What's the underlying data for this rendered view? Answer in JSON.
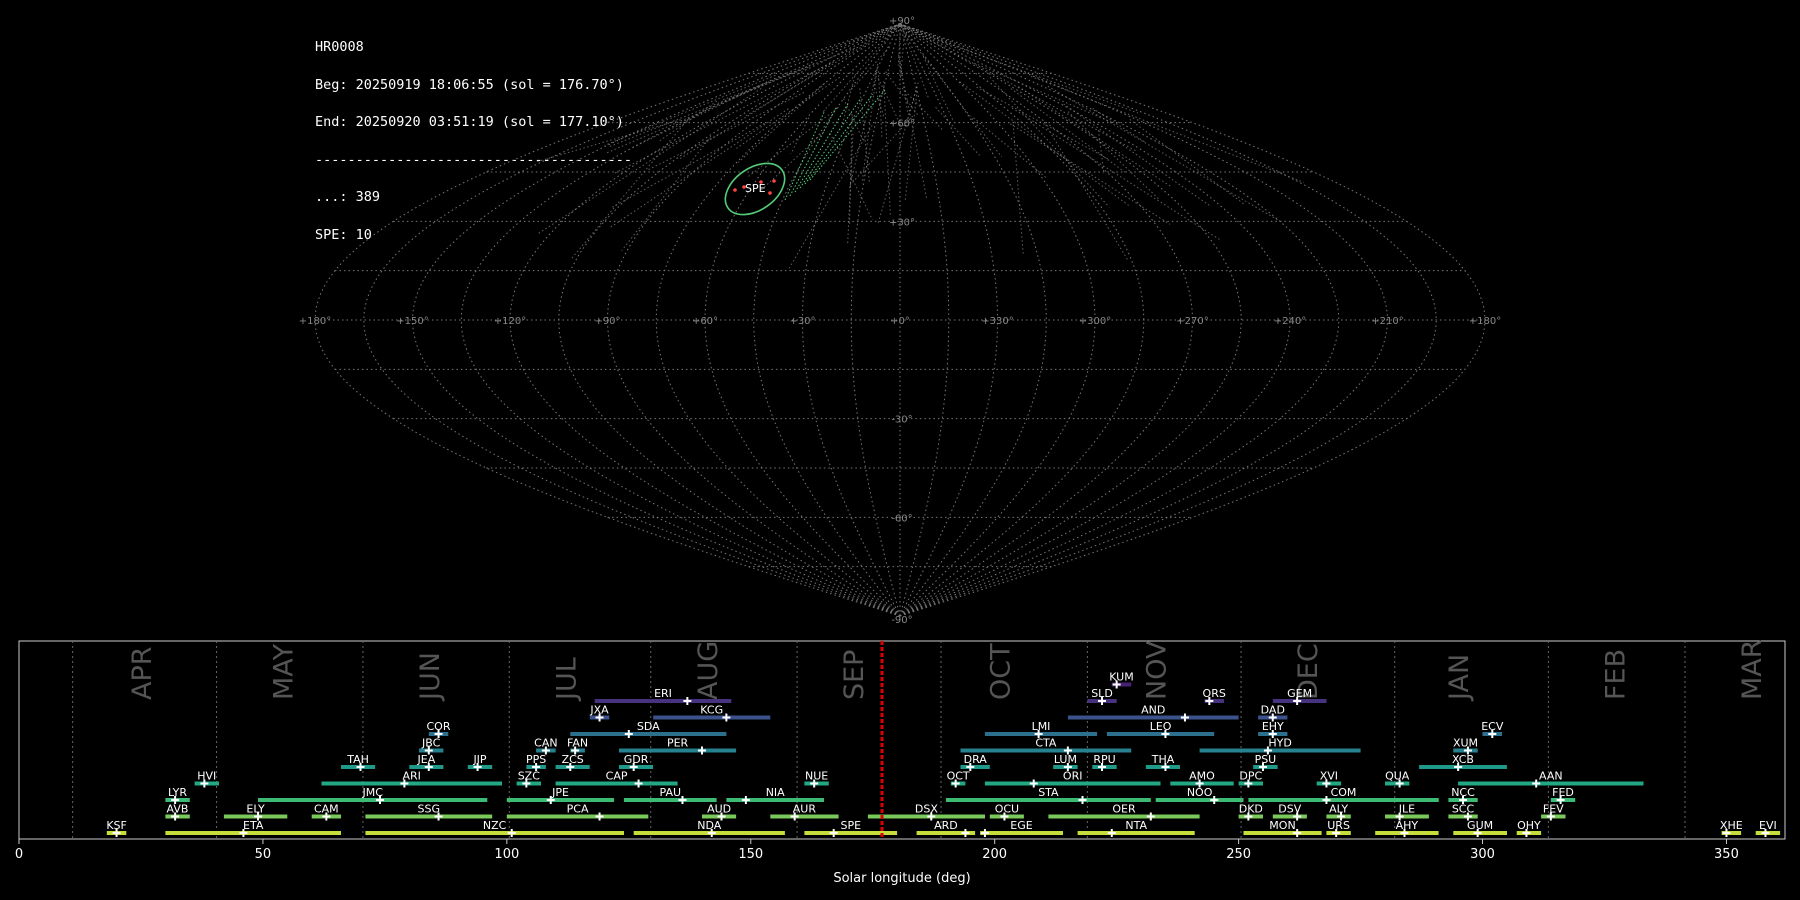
{
  "info": {
    "lines": [
      "HR0008",
      "Beg: 20250919 18:06:55 (sol = 176.70°)",
      "End: 20250920 03:51:19 (sol = 177.10°)",
      "---------------------------------------",
      "...: 389",
      "SPE: 10"
    ]
  },
  "sky": {
    "projection": "sinusoidal",
    "lon_labels": [
      "+180°",
      "+150°",
      "+120°",
      "+90°",
      "+60°",
      "+30°",
      "+0°",
      "+330°",
      "+300°",
      "+270°",
      "+240°",
      "+210°",
      "+180°"
    ],
    "lat_labels": [
      "+90°",
      "+60°",
      "+30°",
      "-30°",
      "-60°",
      "-90°"
    ],
    "highlight_label": "SPE",
    "highlight_color": "#55cc77",
    "track_color": "#888888",
    "spe_color": "#ff4444"
  },
  "chart_data": {
    "type": "timeline",
    "xlabel": "Solar longitude (deg)",
    "xlim": [
      0,
      362
    ],
    "xticks": [
      0,
      50,
      100,
      150,
      200,
      250,
      300,
      350
    ],
    "current_sol": 176.9,
    "current_color": "#dd0000",
    "months": [
      {
        "name": "APR",
        "sol": 25
      },
      {
        "name": "MAY",
        "sol": 54
      },
      {
        "name": "JUN",
        "sol": 84
      },
      {
        "name": "JUL",
        "sol": 112
      },
      {
        "name": "AUG",
        "sol": 141
      },
      {
        "name": "SEP",
        "sol": 171
      },
      {
        "name": "OCT",
        "sol": 201
      },
      {
        "name": "NOV",
        "sol": 233
      },
      {
        "name": "DEC",
        "sol": 264
      },
      {
        "name": "JAN",
        "sol": 295
      },
      {
        "name": "FEB",
        "sol": 327
      },
      {
        "name": "MAR",
        "sol": 355
      }
    ],
    "month_dividers": [
      11,
      40.5,
      70.5,
      100.5,
      129.5,
      159.5,
      189,
      219,
      250.5,
      282,
      313.5,
      341.5
    ],
    "showers": [
      {
        "code": "KSF",
        "start": 18,
        "end": 22,
        "peak": 20,
        "row": 0,
        "color": "#c7dd3a"
      },
      {
        "code": "ETA",
        "start": 30,
        "end": 66,
        "peak": 46,
        "row": 0,
        "color": "#c7dd3a"
      },
      {
        "code": "NZC",
        "start": 71,
        "end": 124,
        "peak": 101,
        "row": 0,
        "color": "#c7dd3a"
      },
      {
        "code": "NDA",
        "start": 126,
        "end": 157,
        "peak": 142,
        "row": 0,
        "color": "#c7dd3a"
      },
      {
        "code": "SPE",
        "start": 161,
        "end": 180,
        "peak": 167,
        "row": 0,
        "color": "#c7dd3a"
      },
      {
        "code": "ARD",
        "start": 184,
        "end": 196,
        "peak": 194,
        "row": 0,
        "color": "#c7dd3a"
      },
      {
        "code": "EGE",
        "start": 197,
        "end": 214,
        "peak": 198,
        "row": 0,
        "color": "#c7dd3a"
      },
      {
        "code": "NTA",
        "start": 217,
        "end": 241,
        "peak": 224,
        "row": 0,
        "color": "#c7dd3a"
      },
      {
        "code": "MON",
        "start": 251,
        "end": 267,
        "peak": 262,
        "row": 0,
        "color": "#c7dd3a"
      },
      {
        "code": "URS",
        "start": 268,
        "end": 273,
        "peak": 270,
        "row": 0,
        "color": "#c7dd3a"
      },
      {
        "code": "AHY",
        "start": 278,
        "end": 291,
        "peak": 284,
        "row": 0,
        "color": "#c7dd3a"
      },
      {
        "code": "GUM",
        "start": 294,
        "end": 305,
        "peak": 299,
        "row": 0,
        "color": "#c7dd3a"
      },
      {
        "code": "OHY",
        "start": 307,
        "end": 312,
        "peak": 309,
        "row": 0,
        "color": "#c7dd3a"
      },
      {
        "code": "XHE",
        "start": 349,
        "end": 353,
        "peak": 350,
        "row": 0,
        "color": "#c7dd3a"
      },
      {
        "code": "EVI",
        "start": 356,
        "end": 361,
        "peak": 358,
        "row": 0,
        "color": "#c7dd3a"
      },
      {
        "code": "AVB",
        "start": 30,
        "end": 35,
        "peak": 32,
        "row": 1,
        "color": "#7ac95b"
      },
      {
        "code": "ELY",
        "start": 42,
        "end": 55,
        "peak": 49,
        "row": 1,
        "color": "#7ac95b"
      },
      {
        "code": "CAM",
        "start": 60,
        "end": 66,
        "peak": 63,
        "row": 1,
        "color": "#7ac95b"
      },
      {
        "code": "SSG",
        "start": 71,
        "end": 97,
        "peak": 86,
        "row": 1,
        "color": "#7ac95b"
      },
      {
        "code": "PCA",
        "start": 100,
        "end": 129,
        "peak": 119,
        "row": 1,
        "color": "#7ac95b"
      },
      {
        "code": "AUD",
        "start": 140,
        "end": 147,
        "peak": 144,
        "row": 1,
        "color": "#7ac95b"
      },
      {
        "code": "AUR",
        "start": 154,
        "end": 168,
        "peak": 159,
        "row": 1,
        "color": "#7ac95b"
      },
      {
        "code": "DSX",
        "start": 174,
        "end": 198,
        "peak": 187,
        "row": 1,
        "color": "#7ac95b"
      },
      {
        "code": "OCU",
        "start": 199,
        "end": 206,
        "peak": 202,
        "row": 1,
        "color": "#7ac95b"
      },
      {
        "code": "OER",
        "start": 211,
        "end": 242,
        "peak": 232,
        "row": 1,
        "color": "#7ac95b"
      },
      {
        "code": "DKD",
        "start": 250,
        "end": 255,
        "peak": 252,
        "row": 1,
        "color": "#7ac95b"
      },
      {
        "code": "DSV",
        "start": 257,
        "end": 264,
        "peak": 262,
        "row": 1,
        "color": "#7ac95b"
      },
      {
        "code": "ALY",
        "start": 268,
        "end": 273,
        "peak": 271,
        "row": 1,
        "color": "#7ac95b"
      },
      {
        "code": "ILE",
        "start": 280,
        "end": 289,
        "peak": 283,
        "row": 1,
        "color": "#7ac95b"
      },
      {
        "code": "SCC",
        "start": 293,
        "end": 299,
        "peak": 297,
        "row": 1,
        "color": "#7ac95b"
      },
      {
        "code": "FEV",
        "start": 312,
        "end": 317,
        "peak": 314,
        "row": 1,
        "color": "#7ac95b"
      },
      {
        "code": "LYR",
        "start": 30,
        "end": 35,
        "peak": 32,
        "row": 2,
        "color": "#3dbb75"
      },
      {
        "code": "JMC",
        "start": 49,
        "end": 96,
        "peak": 74,
        "row": 2,
        "color": "#3dbb75"
      },
      {
        "code": "JPE",
        "start": 100,
        "end": 122,
        "peak": 109,
        "row": 2,
        "color": "#3dbb75"
      },
      {
        "code": "PAU",
        "start": 124,
        "end": 143,
        "peak": 136,
        "row": 2,
        "color": "#3dbb75"
      },
      {
        "code": "NIA",
        "start": 145,
        "end": 165,
        "peak": 149,
        "row": 2,
        "color": "#3dbb75"
      },
      {
        "code": "STA",
        "start": 190,
        "end": 232,
        "peak": 218,
        "row": 2,
        "color": "#3dbb75"
      },
      {
        "code": "NOO",
        "start": 233,
        "end": 251,
        "peak": 245,
        "row": 2,
        "color": "#3dbb75"
      },
      {
        "code": "COM",
        "start": 252,
        "end": 291,
        "peak": 268,
        "row": 2,
        "color": "#3dbb75"
      },
      {
        "code": "NCC",
        "start": 293,
        "end": 299,
        "peak": 296,
        "row": 2,
        "color": "#3dbb75"
      },
      {
        "code": "FED",
        "start": 314,
        "end": 319,
        "peak": 316,
        "row": 2,
        "color": "#3dbb75"
      },
      {
        "code": "HVI",
        "start": 36,
        "end": 41,
        "peak": 38,
        "row": 3,
        "color": "#22a884"
      },
      {
        "code": "ARI",
        "start": 62,
        "end": 99,
        "peak": 79,
        "row": 3,
        "color": "#22a884"
      },
      {
        "code": "SZC",
        "start": 102,
        "end": 107,
        "peak": 104,
        "row": 3,
        "color": "#22a884"
      },
      {
        "code": "CAP",
        "start": 110,
        "end": 135,
        "peak": 127,
        "row": 3,
        "color": "#22a884"
      },
      {
        "code": "NUE",
        "start": 161,
        "end": 166,
        "peak": 163,
        "row": 3,
        "color": "#22a884"
      },
      {
        "code": "OCT",
        "start": 191,
        "end": 194,
        "peak": 192,
        "row": 3,
        "color": "#22a884"
      },
      {
        "code": "ORI",
        "start": 198,
        "end": 234,
        "peak": 208,
        "row": 3,
        "color": "#22a884"
      },
      {
        "code": "AMO",
        "start": 236,
        "end": 249,
        "peak": 242,
        "row": 3,
        "color": "#22a884"
      },
      {
        "code": "DPC",
        "start": 250,
        "end": 255,
        "peak": 252,
        "row": 3,
        "color": "#22a884"
      },
      {
        "code": "XVI",
        "start": 266,
        "end": 271,
        "peak": 268,
        "row": 3,
        "color": "#22a884"
      },
      {
        "code": "QUA",
        "start": 280,
        "end": 285,
        "peak": 283,
        "row": 3,
        "color": "#22a884"
      },
      {
        "code": "AAN",
        "start": 295,
        "end": 333,
        "peak": 311,
        "row": 3,
        "color": "#22a884"
      },
      {
        "code": "TAH",
        "start": 66,
        "end": 73,
        "peak": 70,
        "row": 4,
        "color": "#1f9a8a"
      },
      {
        "code": "JEA",
        "start": 80,
        "end": 87,
        "peak": 84,
        "row": 4,
        "color": "#1f9a8a"
      },
      {
        "code": "JIP",
        "start": 92,
        "end": 97,
        "peak": 94,
        "row": 4,
        "color": "#1f9a8a"
      },
      {
        "code": "PPS",
        "start": 104,
        "end": 108,
        "peak": 106,
        "row": 4,
        "color": "#1f9a8a"
      },
      {
        "code": "ZCS",
        "start": 110,
        "end": 117,
        "peak": 113,
        "row": 4,
        "color": "#1f9a8a"
      },
      {
        "code": "GDR",
        "start": 123,
        "end": 130,
        "peak": 126,
        "row": 4,
        "color": "#1f9a8a"
      },
      {
        "code": "DRA",
        "start": 193,
        "end": 199,
        "peak": 195,
        "row": 4,
        "color": "#1f9a8a"
      },
      {
        "code": "LUM",
        "start": 212,
        "end": 217,
        "peak": 215,
        "row": 4,
        "color": "#1f9a8a"
      },
      {
        "code": "RPU",
        "start": 220,
        "end": 225,
        "peak": 222,
        "row": 4,
        "color": "#1f9a8a"
      },
      {
        "code": "THA",
        "start": 231,
        "end": 238,
        "peak": 235,
        "row": 4,
        "color": "#1f9a8a"
      },
      {
        "code": "PSU",
        "start": 253,
        "end": 258,
        "peak": 255,
        "row": 4,
        "color": "#1f9a8a"
      },
      {
        "code": "XCB",
        "start": 287,
        "end": 305,
        "peak": 295,
        "row": 4,
        "color": "#1f9a8a"
      },
      {
        "code": "JBC",
        "start": 82,
        "end": 87,
        "peak": 84,
        "row": 5,
        "color": "#26828e"
      },
      {
        "code": "CAN",
        "start": 106,
        "end": 110,
        "peak": 108,
        "row": 5,
        "color": "#26828e"
      },
      {
        "code": "FAN",
        "start": 113,
        "end": 116,
        "peak": 114,
        "row": 5,
        "color": "#26828e"
      },
      {
        "code": "PER",
        "start": 123,
        "end": 147,
        "peak": 140,
        "row": 5,
        "color": "#26828e"
      },
      {
        "code": "CTA",
        "start": 193,
        "end": 228,
        "peak": 215,
        "row": 5,
        "color": "#26828e"
      },
      {
        "code": "HYD",
        "start": 242,
        "end": 275,
        "peak": 256,
        "row": 5,
        "color": "#26828e"
      },
      {
        "code": "XUM",
        "start": 294,
        "end": 299,
        "peak": 297,
        "row": 5,
        "color": "#26828e"
      },
      {
        "code": "COR",
        "start": 84,
        "end": 88,
        "peak": 86,
        "row": 6,
        "color": "#2d708e"
      },
      {
        "code": "SDA",
        "start": 113,
        "end": 145,
        "peak": 125,
        "row": 6,
        "color": "#2d708e"
      },
      {
        "code": "LMI",
        "start": 198,
        "end": 221,
        "peak": 209,
        "row": 6,
        "color": "#2d708e"
      },
      {
        "code": "LEO",
        "start": 223,
        "end": 245,
        "peak": 235,
        "row": 6,
        "color": "#2d708e"
      },
      {
        "code": "EHY",
        "start": 254,
        "end": 260,
        "peak": 257,
        "row": 6,
        "color": "#2d708e"
      },
      {
        "code": "ECV",
        "start": 300,
        "end": 304,
        "peak": 302,
        "row": 6,
        "color": "#2d708e"
      },
      {
        "code": "JXA",
        "start": 117,
        "end": 121,
        "peak": 119,
        "row": 7,
        "color": "#3b528b"
      },
      {
        "code": "KCG",
        "start": 130,
        "end": 154,
        "peak": 145,
        "row": 7,
        "color": "#3b528b"
      },
      {
        "code": "AND",
        "start": 215,
        "end": 250,
        "peak": 239,
        "row": 7,
        "color": "#3b528b"
      },
      {
        "code": "DAD",
        "start": 254,
        "end": 260,
        "peak": 257,
        "row": 7,
        "color": "#3b528b"
      },
      {
        "code": "ERI",
        "start": 118,
        "end": 146,
        "peak": 137,
        "row": 8,
        "color": "#46327e"
      },
      {
        "code": "SLD",
        "start": 219,
        "end": 225,
        "peak": 222,
        "row": 8,
        "color": "#46327e"
      },
      {
        "code": "ORS",
        "start": 243,
        "end": 247,
        "peak": 244,
        "row": 8,
        "color": "#46327e"
      },
      {
        "code": "GEM",
        "start": 257,
        "end": 268,
        "peak": 262,
        "row": 8,
        "color": "#46327e"
      },
      {
        "code": "KUM",
        "start": 224,
        "end": 228,
        "peak": 225,
        "row": 9,
        "color": "#482173"
      }
    ]
  }
}
